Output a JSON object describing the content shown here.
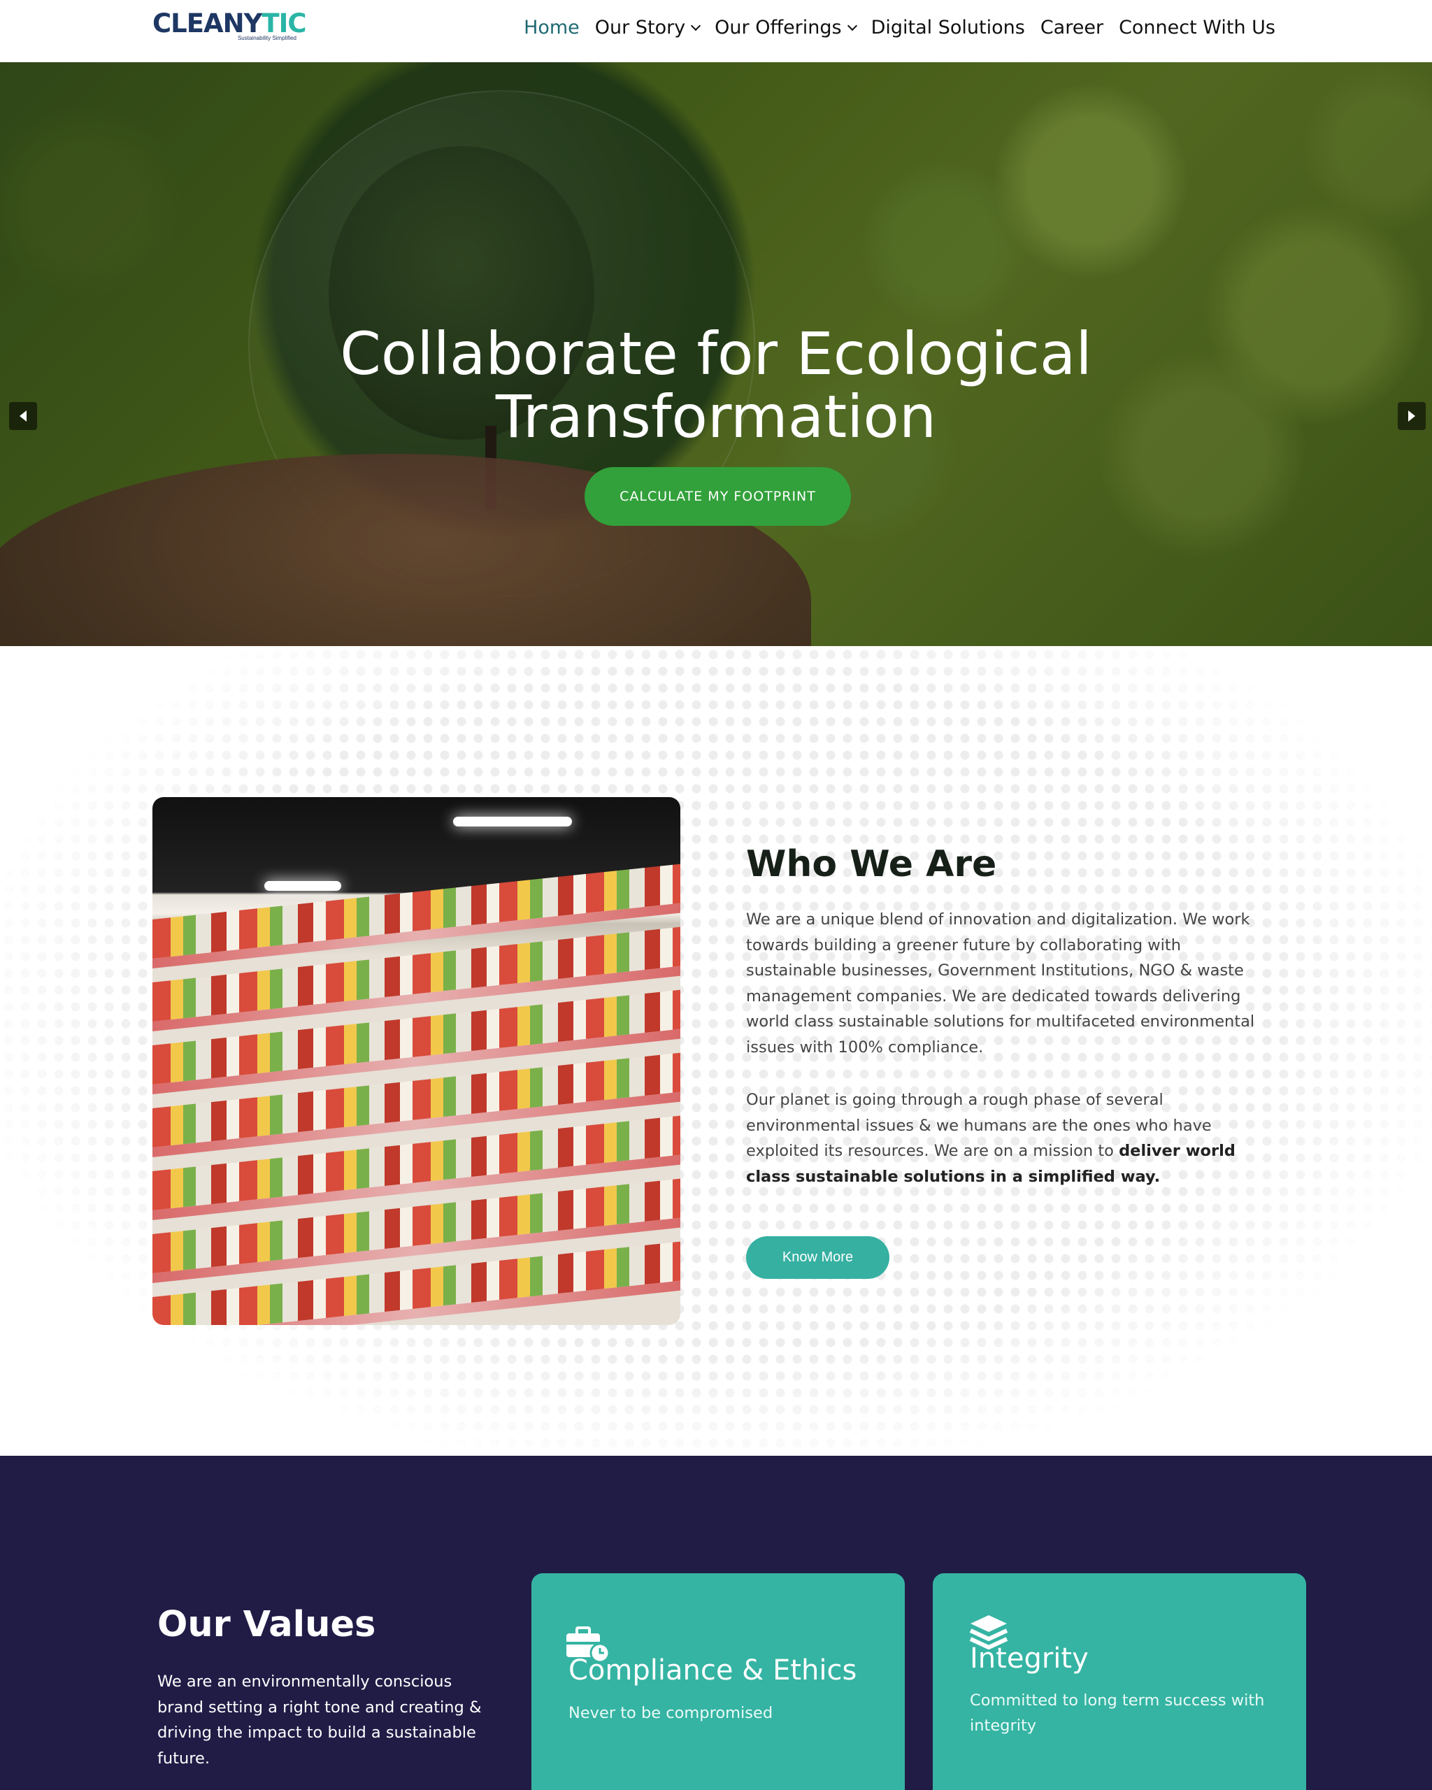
{
  "header": {
    "logo_main": "CLEANYTIC",
    "logo_tagline": "Sustainability Simplified",
    "nav": [
      {
        "label": "Home",
        "active": true
      },
      {
        "label": "Our Story",
        "dropdown": true
      },
      {
        "label": "Our Offerings",
        "dropdown": true
      },
      {
        "label": "Digital Solutions"
      },
      {
        "label": "Career"
      },
      {
        "label": "Connect With Us"
      }
    ]
  },
  "hero": {
    "title_line1": "Collaborate for Ecological",
    "title_line2": "Transformation",
    "cta_label": "CALCULATE MY FOOTPRINT",
    "slides": 4,
    "active_slide": 2
  },
  "who": {
    "title": "Who We Are",
    "paragraph1": "We are a unique blend of innovation and digitalization. We work towards building a greener future by collaborating with sustainable businesses, Government Institutions, NGO & waste management companies. We are dedicated towards delivering world class sustainable solutions for multifaceted environmental issues with 100% compliance.",
    "paragraph2_plain": "Our planet is going through a rough phase of several environmental issues & we humans are the ones who have exploited its resources. We are on a mission to ",
    "paragraph2_bold": "deliver world class sustainable solutions in a simplified way.",
    "button_label": "Know More",
    "image_icon": "supermarket-shelves-photo"
  },
  "values": {
    "title": "Our Values",
    "description": "We are an environmentally conscious brand setting a right tone and creating & driving the impact to build a sustainable future.",
    "cards": [
      {
        "title": "Compliance & Ethics",
        "text": "Never to be compromised",
        "icon": "briefcase-clock-icon"
      },
      {
        "title": "Integrity",
        "text": "Committed to long term success with integrity",
        "icon": "layers-icon"
      }
    ]
  },
  "colors": {
    "accent_teal": "#35b0a1",
    "cta_green": "#32a13b",
    "values_bg": "#211c46",
    "nav_active": "#1f6a73"
  }
}
